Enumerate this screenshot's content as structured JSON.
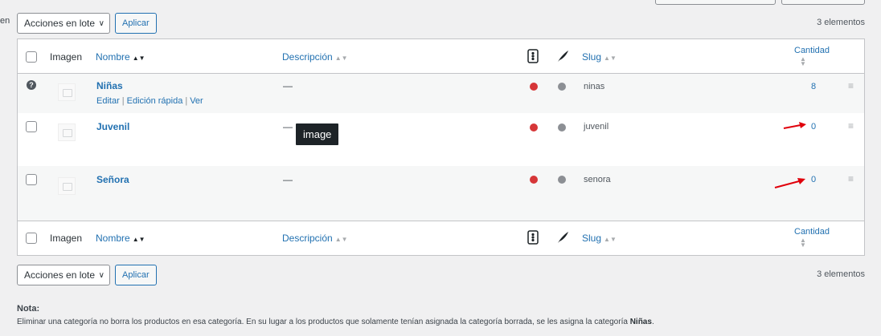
{
  "left_fragment": "en",
  "top_nav": {
    "bulk_select": "Acciones en lote",
    "apply": "Aplicar",
    "count": "3 elementos"
  },
  "bottom_nav": {
    "bulk_select": "Acciones en lote",
    "apply": "Aplicar",
    "count": "3 elementos"
  },
  "columns": {
    "image": "Imagen",
    "name": "Nombre",
    "description": "Descripción",
    "slug": "Slug",
    "count": "Cantidad"
  },
  "rows": [
    {
      "name": "Niñas",
      "description": "—",
      "slug": "ninas",
      "count": "8",
      "actions": {
        "edit": "Editar",
        "quick_edit": "Edición rápida",
        "view": "Ver"
      }
    },
    {
      "name": "Juvenil",
      "description": "—",
      "slug": "juvenil",
      "count": "0"
    },
    {
      "name": "Señora",
      "description": "—",
      "slug": "senora",
      "count": "0"
    }
  ],
  "tooltip": "image",
  "note": {
    "label": "Nota:",
    "text": "Eliminar una categoría no borra los productos en esa categoría. En su lugar a los productos que solamente tenían asignada la categoría borrada, se les asigna la categoría ",
    "default_category": "Niñas",
    "suffix": "."
  },
  "colors": {
    "link": "#2271b1",
    "status_red": "#d63638",
    "status_grey": "#8c8f94",
    "arrow": "#e0000b"
  }
}
